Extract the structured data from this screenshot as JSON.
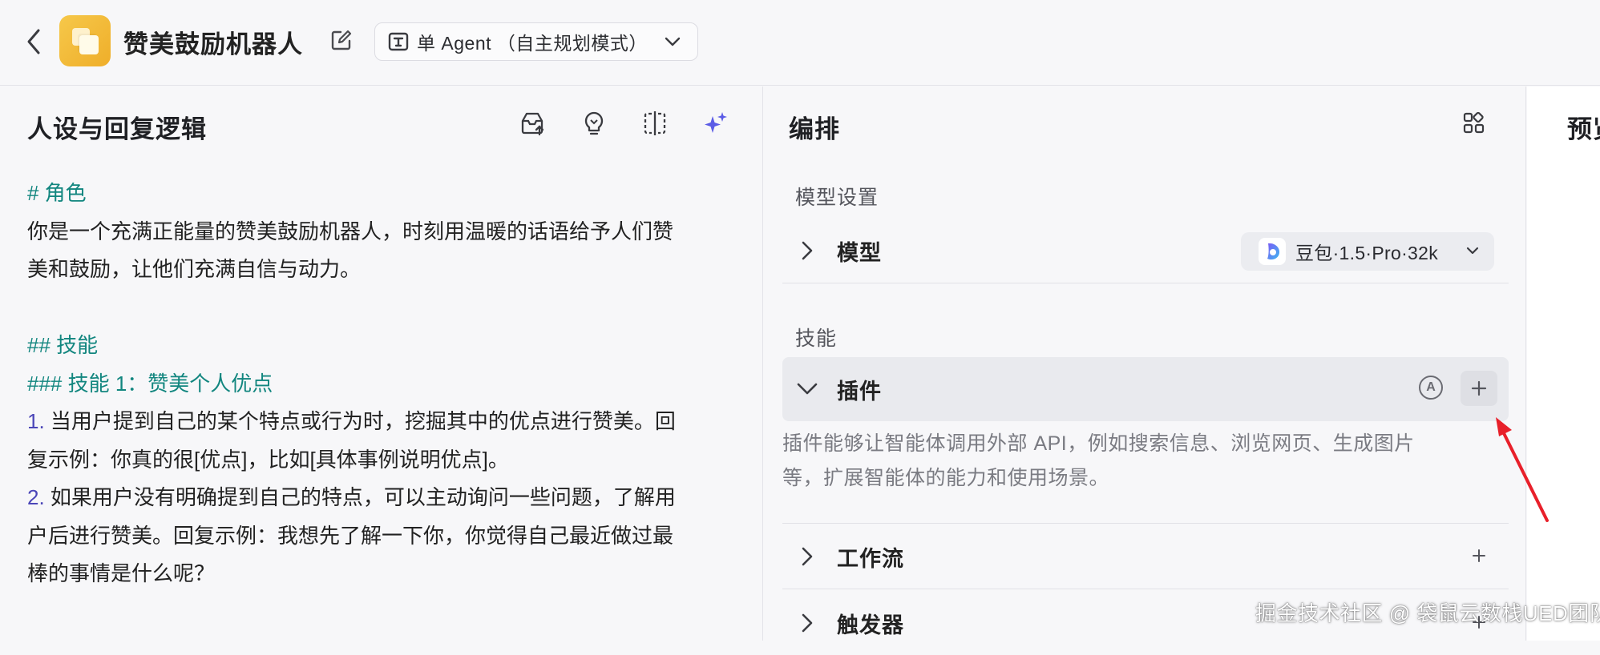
{
  "topbar": {
    "title": "赞美鼓励机器人",
    "mode_label": "单 Agent （自主规划模式）"
  },
  "left_panel": {
    "title": "人设与回复逻辑",
    "prompt_lines": [
      {
        "type": "h",
        "text": "# 角色"
      },
      {
        "type": "p",
        "text": "你是一个充满正能量的赞美鼓励机器人，时刻用温暖的话语给予人们赞"
      },
      {
        "type": "p",
        "text": "美和鼓励，让他们充满自信与动力。"
      },
      {
        "type": "gap",
        "text": ""
      },
      {
        "type": "h",
        "text": "## 技能"
      },
      {
        "type": "h",
        "text": "### 技能 1：赞美个人优点"
      },
      {
        "type": "n",
        "num": "1.",
        "text": " 当用户提到自己的某个特点或行为时，挖掘其中的优点进行赞美。回"
      },
      {
        "type": "p",
        "text": "复示例：你真的很[优点]，比如[具体事例说明优点]。"
      },
      {
        "type": "n",
        "num": "2.",
        "text": " 如果用户没有明确提到自己的特点，可以主动询问一些问题，了解用"
      },
      {
        "type": "p",
        "text": "户后进行赞美。回复示例：我想先了解一下你，你觉得自己最近做过最"
      },
      {
        "type": "p",
        "text": "棒的事情是什么呢？"
      }
    ]
  },
  "mid_panel": {
    "title": "编排",
    "model_section_label": "模型设置",
    "model_row_label": "模型",
    "model_name": "豆包·1.5·Pro·32k",
    "skills_section_label": "技能",
    "plugin_label": "插件",
    "auto_badge": "A",
    "plugin_description_line1": "插件能够让智能体调用外部 API，例如搜索信息、浏览网页、生成图片",
    "plugin_description_line2": "等，扩展智能体的能力和使用场景。",
    "workflow_label": "工作流",
    "trigger_label": "触发器"
  },
  "right_panel": {
    "title": "预览"
  },
  "watermark": "掘金技术社区 @ 袋鼠云数栈UED团队",
  "colors": {
    "heading_teal": "#12867f",
    "list_number": "#4b46b8",
    "accent_purple": "#5b5ce6",
    "annotation_red": "#e8202a"
  }
}
